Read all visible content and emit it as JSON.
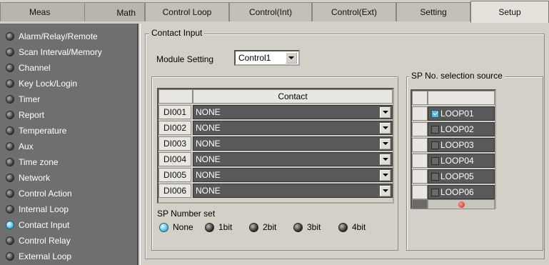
{
  "tabs": [
    {
      "label": "Meas"
    },
    {
      "label": "Math"
    },
    {
      "label": "Control Loop"
    },
    {
      "label": "Control(Int)"
    },
    {
      "label": "Control(Ext)"
    },
    {
      "label": "Setting"
    },
    {
      "label": "Setup",
      "active": true
    }
  ],
  "sidebar": {
    "items": [
      {
        "label": "Alarm/Relay/Remote"
      },
      {
        "label": "Scan Interval/Memory"
      },
      {
        "label": "Channel"
      },
      {
        "label": "Key Lock/Login"
      },
      {
        "label": "Timer"
      },
      {
        "label": "Report"
      },
      {
        "label": "Temperature"
      },
      {
        "label": "Aux"
      },
      {
        "label": "Time zone"
      },
      {
        "label": "Network"
      },
      {
        "label": "Control Action"
      },
      {
        "label": "Internal Loop"
      },
      {
        "label": "Contact Input",
        "selected": true
      },
      {
        "label": "Control Relay"
      },
      {
        "label": "External Loop"
      }
    ]
  },
  "contact_input": {
    "title": "Contact Input",
    "module_setting_label": "Module Setting",
    "module_setting_value": "Control1",
    "table_header": "Contact",
    "rows": [
      {
        "id": "DI001",
        "value": "NONE"
      },
      {
        "id": "DI002",
        "value": "NONE"
      },
      {
        "id": "DI003",
        "value": "NONE"
      },
      {
        "id": "DI004",
        "value": "NONE"
      },
      {
        "id": "DI005",
        "value": "NONE"
      },
      {
        "id": "DI006",
        "value": "NONE"
      }
    ],
    "sp_number_set": {
      "label": "SP Number set",
      "options": [
        "None",
        "1bit",
        "2bit",
        "3bit",
        "4bit"
      ],
      "selected": "None"
    }
  },
  "sp_selection": {
    "title": "SP No. selection source",
    "loops": [
      {
        "label": "LOOP01",
        "checked": true
      },
      {
        "label": "LOOP02",
        "checked": false
      },
      {
        "label": "LOOP03",
        "checked": false
      },
      {
        "label": "LOOP04",
        "checked": false
      },
      {
        "label": "LOOP05",
        "checked": false
      },
      {
        "label": "LOOP06",
        "checked": false
      }
    ]
  },
  "colors": {
    "nav_bg": "#6f6f6f",
    "panel_bg": "#d4d0c8",
    "selected_indicator": "#5fc8e8",
    "field_bg": "#595959"
  }
}
